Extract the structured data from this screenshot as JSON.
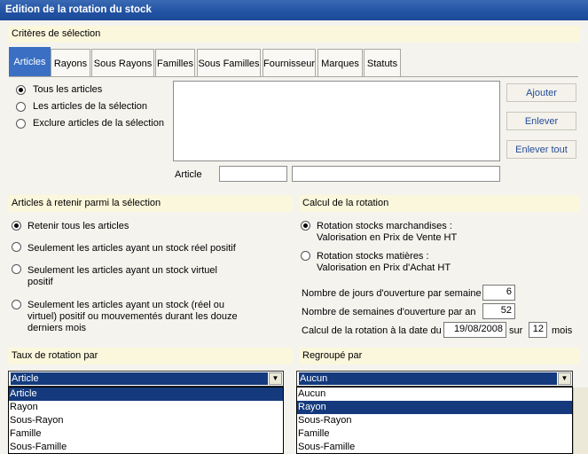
{
  "window": {
    "title": "Edition de la rotation du stock"
  },
  "criteria": {
    "header": "Critères de sélection",
    "tabs": [
      {
        "label": "Articles",
        "active": true
      },
      {
        "label": "Rayons"
      },
      {
        "label": "Sous Rayons"
      },
      {
        "label": "Familles"
      },
      {
        "label": "Sous Familles"
      },
      {
        "label": "Fournisseur"
      },
      {
        "label": "Marques"
      },
      {
        "label": "Statuts"
      }
    ],
    "options": [
      {
        "label": "Tous les articles",
        "selected": true
      },
      {
        "label": "Les articles de la sélection",
        "selected": false
      },
      {
        "label": "Exclure articles de la sélection",
        "selected": false
      }
    ],
    "buttons": {
      "add": "Ajouter",
      "remove": "Enlever",
      "remove_all": "Enlever tout"
    },
    "article_label": "Article",
    "article_code": "",
    "article_name": ""
  },
  "retain": {
    "header": "Articles à retenir parmi la sélection",
    "options": [
      {
        "label": "Retenir tous les articles",
        "selected": true
      },
      {
        "label": "Seulement les articles ayant un stock réel positif",
        "selected": false
      },
      {
        "label": "Seulement les articles ayant un stock virtuel positif",
        "selected": false
      },
      {
        "label": "Seulement les articles  ayant un stock (réel ou virtuel) positif ou mouvementés durant les douze derniers mois",
        "selected": false
      }
    ]
  },
  "calc": {
    "header": "Calcul de la rotation",
    "options": [
      {
        "line1": "Rotation stocks marchandises :",
        "line2": "Valorisation en Prix de Vente HT",
        "selected": true
      },
      {
        "line1": "Rotation stocks matières :",
        "line2": "Valorisation en Prix d'Achat HT",
        "selected": false
      }
    ],
    "days_label": "Nombre de jours d'ouverture par semaine",
    "days_value": "6",
    "weeks_label": "Nombre de semaines d'ouverture par an",
    "weeks_value": "52",
    "date_label": "Calcul de la rotation à la date du",
    "date_value": "19/08/2008",
    "over_label": "sur",
    "months_value": "12",
    "months_unit": "mois"
  },
  "rate": {
    "header": "Taux de rotation par",
    "selected": "Article",
    "options": [
      "Article",
      "Rayon",
      "Sous-Rayon",
      "Famille",
      "Sous-Famille"
    ],
    "highlighted_index": 0
  },
  "group": {
    "header": "Regroupé par",
    "selected": "Aucun",
    "options": [
      "Aucun",
      "Rayon",
      "Sous-Rayon",
      "Famille",
      "Sous-Famille"
    ],
    "highlighted_index": 1
  }
}
